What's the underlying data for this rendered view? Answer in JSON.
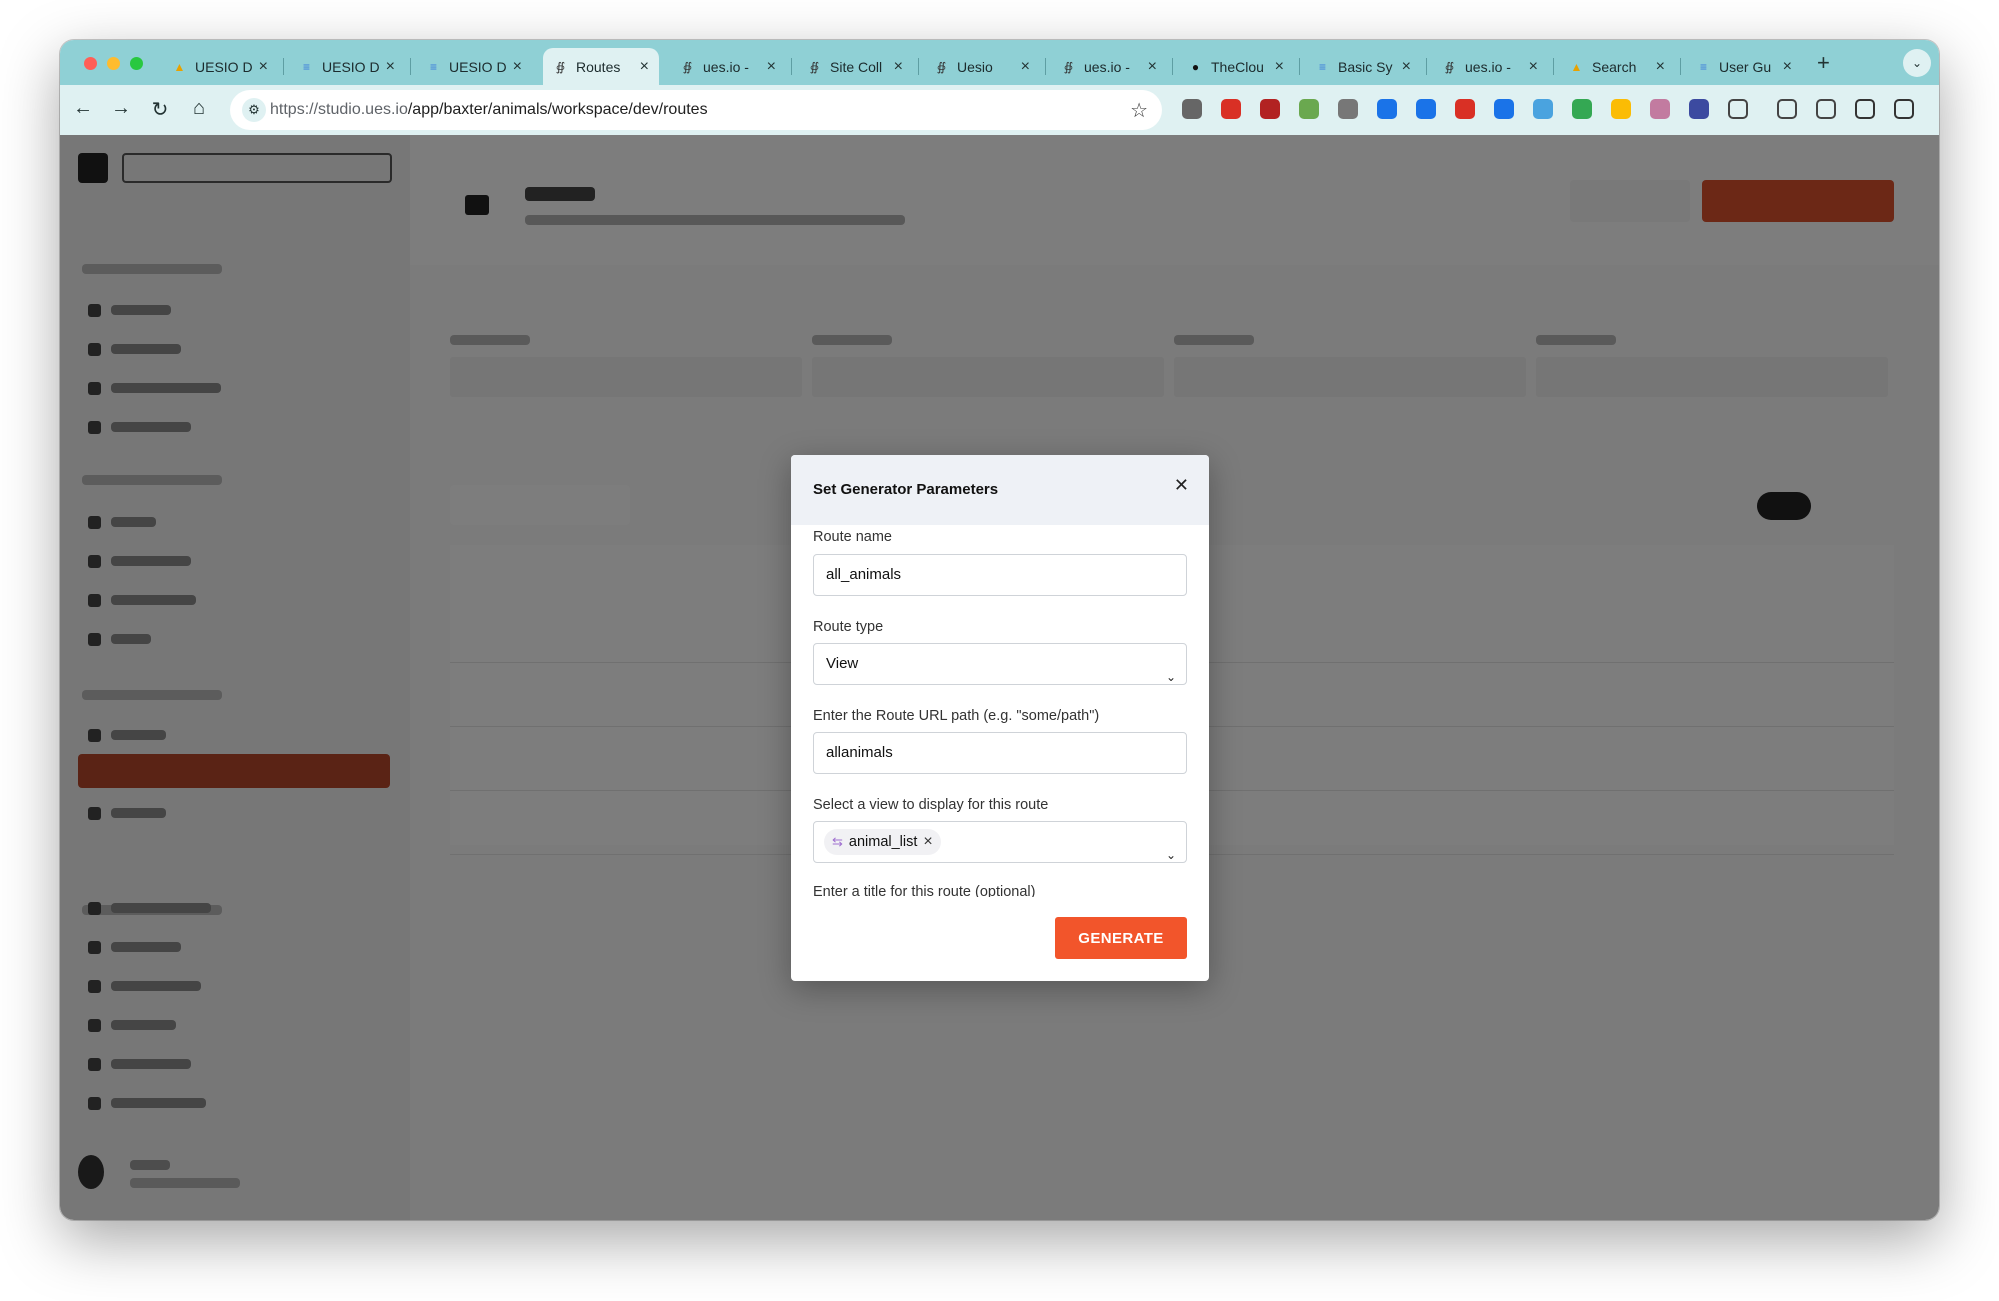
{
  "browser": {
    "tabs": [
      {
        "label": "UESIO D",
        "icon": "drive-icon"
      },
      {
        "label": "UESIO D",
        "icon": "docs-icon"
      },
      {
        "label": "UESIO D",
        "icon": "docs-icon"
      },
      {
        "label": "Routes",
        "icon": "uesio-icon"
      },
      {
        "label": "ues.io -",
        "icon": "uesio-icon"
      },
      {
        "label": "Site Coll",
        "icon": "uesio-icon"
      },
      {
        "label": "Uesio",
        "icon": "uesio-icon"
      },
      {
        "label": "ues.io -",
        "icon": "uesio-icon"
      },
      {
        "label": "TheClou",
        "icon": "github-icon"
      },
      {
        "label": "Basic Sy",
        "icon": "docs-icon"
      },
      {
        "label": "ues.io -",
        "icon": "uesio-icon"
      },
      {
        "label": "Search",
        "icon": "drive-icon"
      },
      {
        "label": "User Gu",
        "icon": "docs-icon"
      }
    ],
    "url_host": "https://studio.ues.io",
    "url_path": "/app/baxter/animals/workspace/dev/routes"
  },
  "modal": {
    "title": "Set Generator Parameters",
    "route_name_label": "Route name",
    "route_name_value": "all_animals",
    "route_type_label": "Route type",
    "route_type_value": "View",
    "path_label": "Enter the Route URL path (e.g. \"some/path\")",
    "path_value": "allanimals",
    "view_label": "Select a view to display for this route",
    "view_chip": "animal_list",
    "title_label": "Enter a title for this route (optional)",
    "generate_label": "GENERATE"
  },
  "colors": {
    "accent": "#f2552b",
    "tabstrip": "#8fd0d5",
    "toolbar": "#dff1f2",
    "sidebar_active": "#b5472b"
  }
}
